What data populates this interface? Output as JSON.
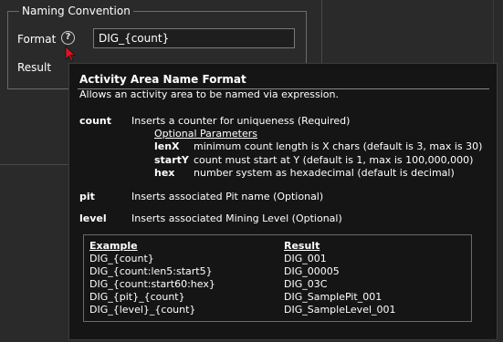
{
  "group": {
    "title": "Naming Convention"
  },
  "format": {
    "label": "Format",
    "value": "DIG_{count}",
    "help_icon": "question-circle-icon"
  },
  "result": {
    "label": "Result"
  },
  "tooltip": {
    "title": "Activity Area Name Format",
    "subtitle": "Allows an activity area to be named via expression.",
    "count": {
      "keyword": "count",
      "description": "Inserts a counter for uniqueness (Required)",
      "optional_header": "Optional Parameters",
      "params": [
        {
          "name": "lenX",
          "description": "minimum count length is X chars (default is 3, max is 30)"
        },
        {
          "name": "startY",
          "description": "count must start at Y (default is 1, max is 100,000,000)"
        },
        {
          "name": "hex",
          "description": "number system as hexadecimal (default is decimal)"
        }
      ]
    },
    "pit": {
      "keyword": "pit",
      "description": "Inserts associated Pit name (Optional)"
    },
    "level": {
      "keyword": "level",
      "description": "Inserts associated Mining Level (Optional)"
    },
    "examples": {
      "example_header": "Example",
      "result_header": "Result",
      "rows": [
        {
          "example": "DIG_{count}",
          "result": "DIG_001"
        },
        {
          "example": "DIG_{count:len5:start5}",
          "result": "DIG_00005"
        },
        {
          "example": "DIG_{count:start60:hex}",
          "result": "DIG_03C"
        },
        {
          "example": "DIG_{pit}_{count}",
          "result": "DIG_SamplePit_001"
        },
        {
          "example": "DIG_{level}_{count}",
          "result": "DIG_SampleLevel_001"
        }
      ]
    }
  },
  "colors": {
    "background": "#2a2a2a",
    "tooltip_bg": "#151515",
    "cursor": "#e81123"
  }
}
